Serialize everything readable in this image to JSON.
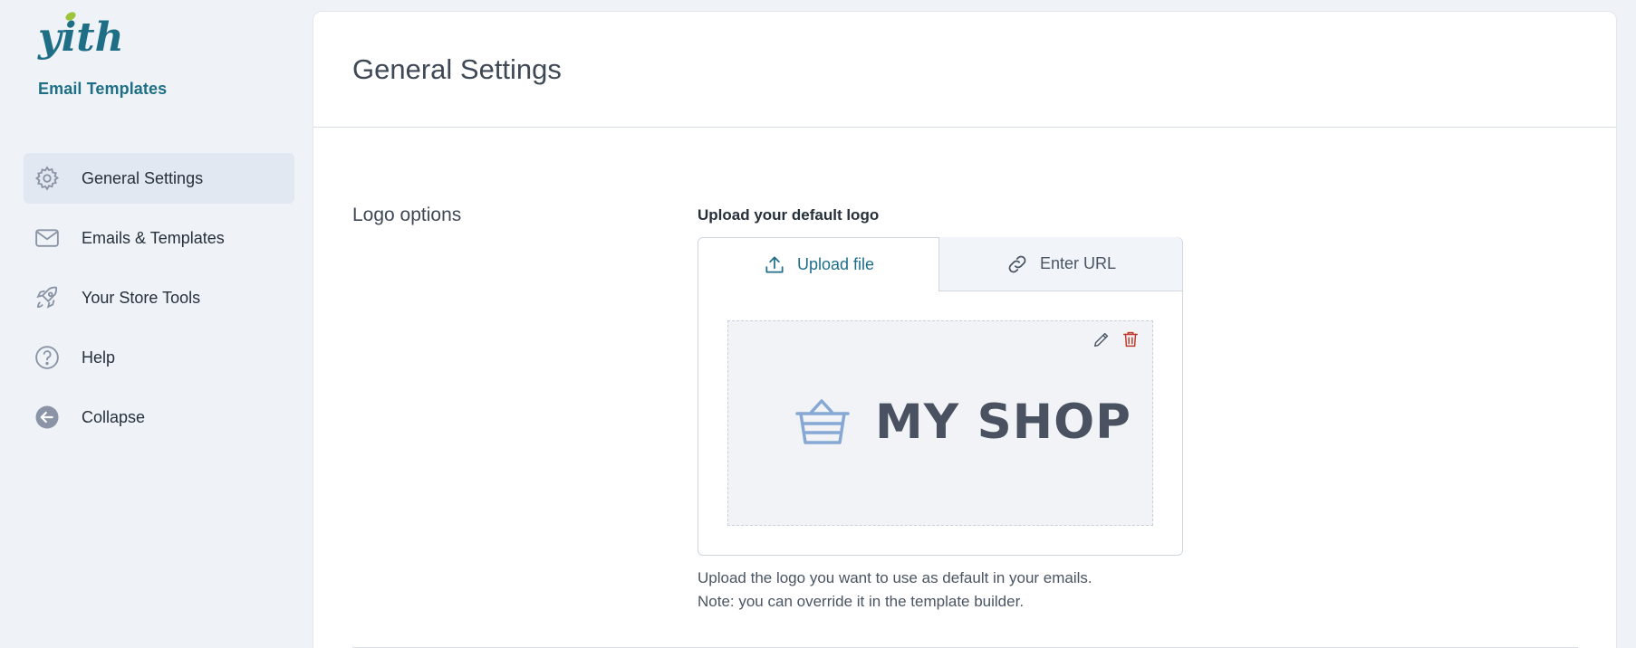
{
  "brand": {
    "logo_text": "yith",
    "product_name": "Email Templates",
    "accent_color": "#1e6f86",
    "leaf_color": "#9ec43a"
  },
  "sidebar": {
    "items": [
      {
        "label": "General Settings",
        "icon": "gear-icon",
        "active": true
      },
      {
        "label": "Emails & Templates",
        "icon": "envelope-icon",
        "active": false
      },
      {
        "label": "Your Store Tools",
        "icon": "rocket-icon",
        "active": false
      },
      {
        "label": "Help",
        "icon": "question-circle-icon",
        "active": false
      },
      {
        "label": "Collapse",
        "icon": "arrow-left-circle-icon",
        "active": false
      }
    ]
  },
  "main": {
    "page_title": "General Settings",
    "section": {
      "title": "Logo options",
      "field_label": "Upload your default logo",
      "tabs": [
        {
          "label": "Upload file",
          "icon": "upload-icon",
          "active": true
        },
        {
          "label": "Enter URL",
          "icon": "link-icon",
          "active": false
        }
      ],
      "preview": {
        "shop_name": "MY SHOP",
        "icon": "basket-icon",
        "actions": [
          {
            "name": "edit",
            "icon": "pencil-icon"
          },
          {
            "name": "delete",
            "icon": "trash-icon",
            "color": "#c0392b"
          }
        ]
      },
      "help_lines": [
        "Upload the logo you want to use as default in your emails.",
        "Note: you can override it in the template builder."
      ]
    }
  }
}
